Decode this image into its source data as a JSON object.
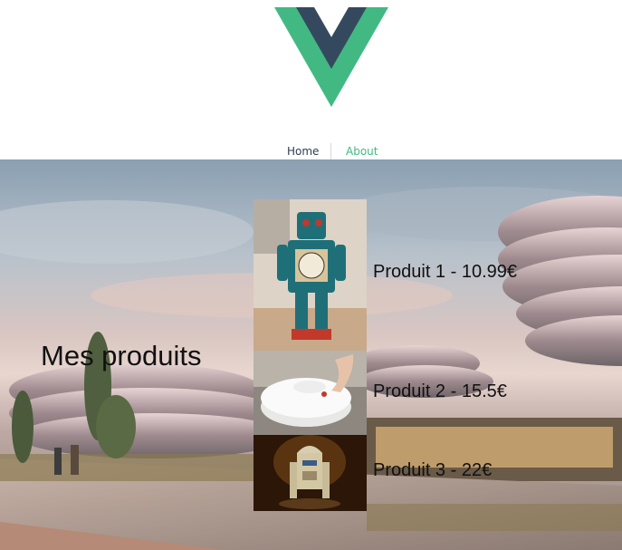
{
  "nav": {
    "items": [
      {
        "label": "Home"
      },
      {
        "label": "About"
      }
    ]
  },
  "colors": {
    "vue_green": "#42b983",
    "vue_dark": "#35495e",
    "nav_text": "#2c3e50"
  },
  "main": {
    "title": "Mes produits",
    "products": [
      {
        "label": "Produit 1 - 10.99€",
        "image": "robot-toy-clock"
      },
      {
        "label": "Produit 2 - 15.5€",
        "image": "robot-vacuum"
      },
      {
        "label": "Produit 3 - 22€",
        "image": "r2d2-figurine"
      }
    ]
  }
}
